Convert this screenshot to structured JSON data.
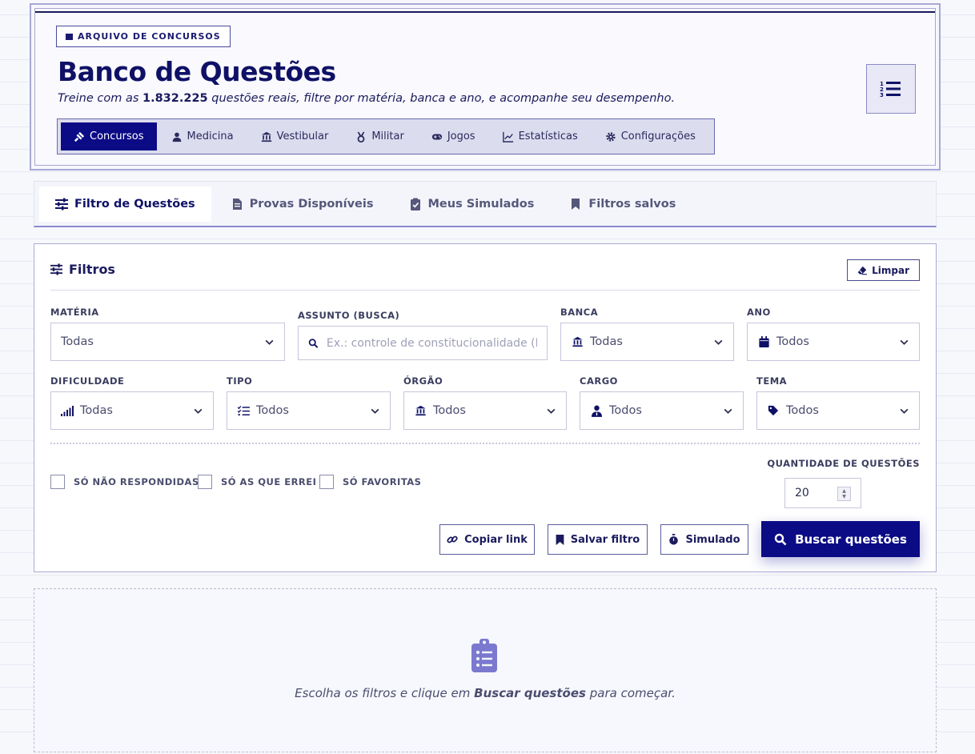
{
  "colors": {
    "brand": "#0b0b86",
    "accent": "#8a8ad0",
    "text": "#1a1a5e"
  },
  "header": {
    "kicker": "ARQUIVO DE CONCURSOS",
    "title": "Banco de Questões",
    "subtitle_pre": "Treine com as",
    "question_count": "1.832.225",
    "subtitle_post": "questões reais, filtre por matéria, banca e ano, e acompanhe seu desempenho.",
    "side_icon": "numbered-list-icon"
  },
  "nav": {
    "items": [
      {
        "label": "Concursos",
        "icon": "gavel-icon",
        "active": true
      },
      {
        "label": "Medicina",
        "icon": "doctor-icon"
      },
      {
        "label": "Vestibular",
        "icon": "building-columns-icon"
      },
      {
        "label": "Militar",
        "icon": "medal-icon"
      },
      {
        "label": "Jogos",
        "icon": "gamepad-icon"
      },
      {
        "label": "Estatísticas",
        "icon": "chart-line-icon"
      },
      {
        "label": "Configurações",
        "icon": "gear-icon"
      }
    ]
  },
  "tabs": [
    {
      "label": "Filtro de Questões",
      "icon": "sliders-icon",
      "active": true
    },
    {
      "label": "Provas Disponíveis",
      "icon": "file-icon"
    },
    {
      "label": "Meus Simulados",
      "icon": "clipboard-check-icon"
    },
    {
      "label": "Filtros salvos",
      "icon": "bookmark-icon"
    }
  ],
  "filters": {
    "heading": "Filtros",
    "clear_label": "Limpar",
    "materia": {
      "label": "MATÉRIA",
      "value": "Todas"
    },
    "assunto": {
      "label": "ASSUNTO (BUSCA)",
      "placeholder": "Ex.: controle de constitucionalidade (Enter para buscar)"
    },
    "banca": {
      "label": "BANCA",
      "value": "Todas"
    },
    "ano": {
      "label": "ANO",
      "value": "Todos"
    },
    "dificuldade": {
      "label": "DIFICULDADE",
      "value": "Todas"
    },
    "tipo": {
      "label": "TIPO",
      "value": "Todos"
    },
    "orgao": {
      "label": "ÓRGÃO",
      "value": "Todos"
    },
    "cargo": {
      "label": "CARGO",
      "value": "Todos"
    },
    "tema": {
      "label": "TEMA",
      "value": "Todos"
    },
    "checks": {
      "nao_respondidas": "SÓ NÃO RESPONDIDAS",
      "erradas": "SÓ AS QUE ERREI",
      "favoritas": "SÓ FAVORITAS"
    },
    "quantidade": {
      "label": "QUANTIDADE DE QUESTÕES",
      "value": "20"
    },
    "buttons": {
      "copy": "Copiar link",
      "save": "Salvar filtro",
      "simulado": "Simulado",
      "search": "Buscar questões"
    }
  },
  "empty": {
    "pre": "Escolha os filtros e clique em",
    "bold": "Buscar questões",
    "post": "para começar."
  }
}
